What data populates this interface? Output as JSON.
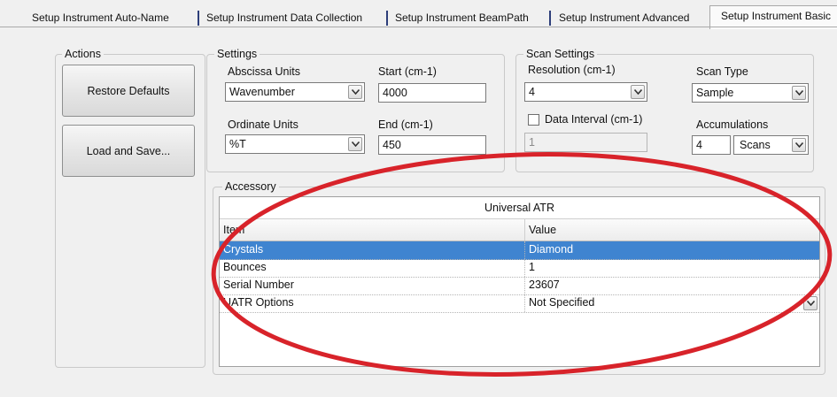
{
  "tabs": [
    {
      "label": "Setup Instrument Auto-Name",
      "active": false
    },
    {
      "label": "Setup Instrument Data Collection",
      "active": false
    },
    {
      "label": "Setup Instrument BeamPath",
      "active": false
    },
    {
      "label": "Setup Instrument Advanced",
      "active": false
    },
    {
      "label": "Setup Instrument Basic",
      "active": true
    }
  ],
  "actions": {
    "title": "Actions",
    "restore_defaults": "Restore Defaults",
    "load_and_save": "Load and Save..."
  },
  "settings": {
    "title": "Settings",
    "abscissa_label": "Abscissa Units",
    "abscissa_value": "Wavenumber",
    "start_label": "Start (cm-1)",
    "start_value": "4000",
    "ordinate_label": "Ordinate Units",
    "ordinate_value": "%T",
    "end_label": "End (cm-1)",
    "end_value": "450"
  },
  "scan_settings": {
    "title": "Scan Settings",
    "resolution_label": "Resolution (cm-1)",
    "resolution_value": "4",
    "scan_type_label": "Scan Type",
    "scan_type_value": "Sample",
    "data_interval_label": "Data Interval (cm-1)",
    "data_interval_checked": false,
    "data_interval_value": "1",
    "accumulations_label": "Accumulations",
    "accumulations_value": "4",
    "accumulations_unit": "Scans"
  },
  "accessory": {
    "title": "Accessory",
    "caption": "Universal ATR",
    "col_item": "Item",
    "col_value": "Value",
    "rows": [
      {
        "item": "Crystals",
        "value": "Diamond",
        "selected": true
      },
      {
        "item": "Bounces",
        "value": "1",
        "selected": false
      },
      {
        "item": "Serial Number",
        "value": "23607",
        "selected": false
      },
      {
        "item": "UATR Options",
        "value": "Not Specified",
        "selected": false
      }
    ]
  },
  "colors": {
    "selection": "#3f84d0",
    "annotation": "#d8232a",
    "tab_separator": "#2d3e7a"
  },
  "icons": {
    "dropdown": "chevron-down-icon",
    "checkbox": "checkbox-unchecked"
  }
}
